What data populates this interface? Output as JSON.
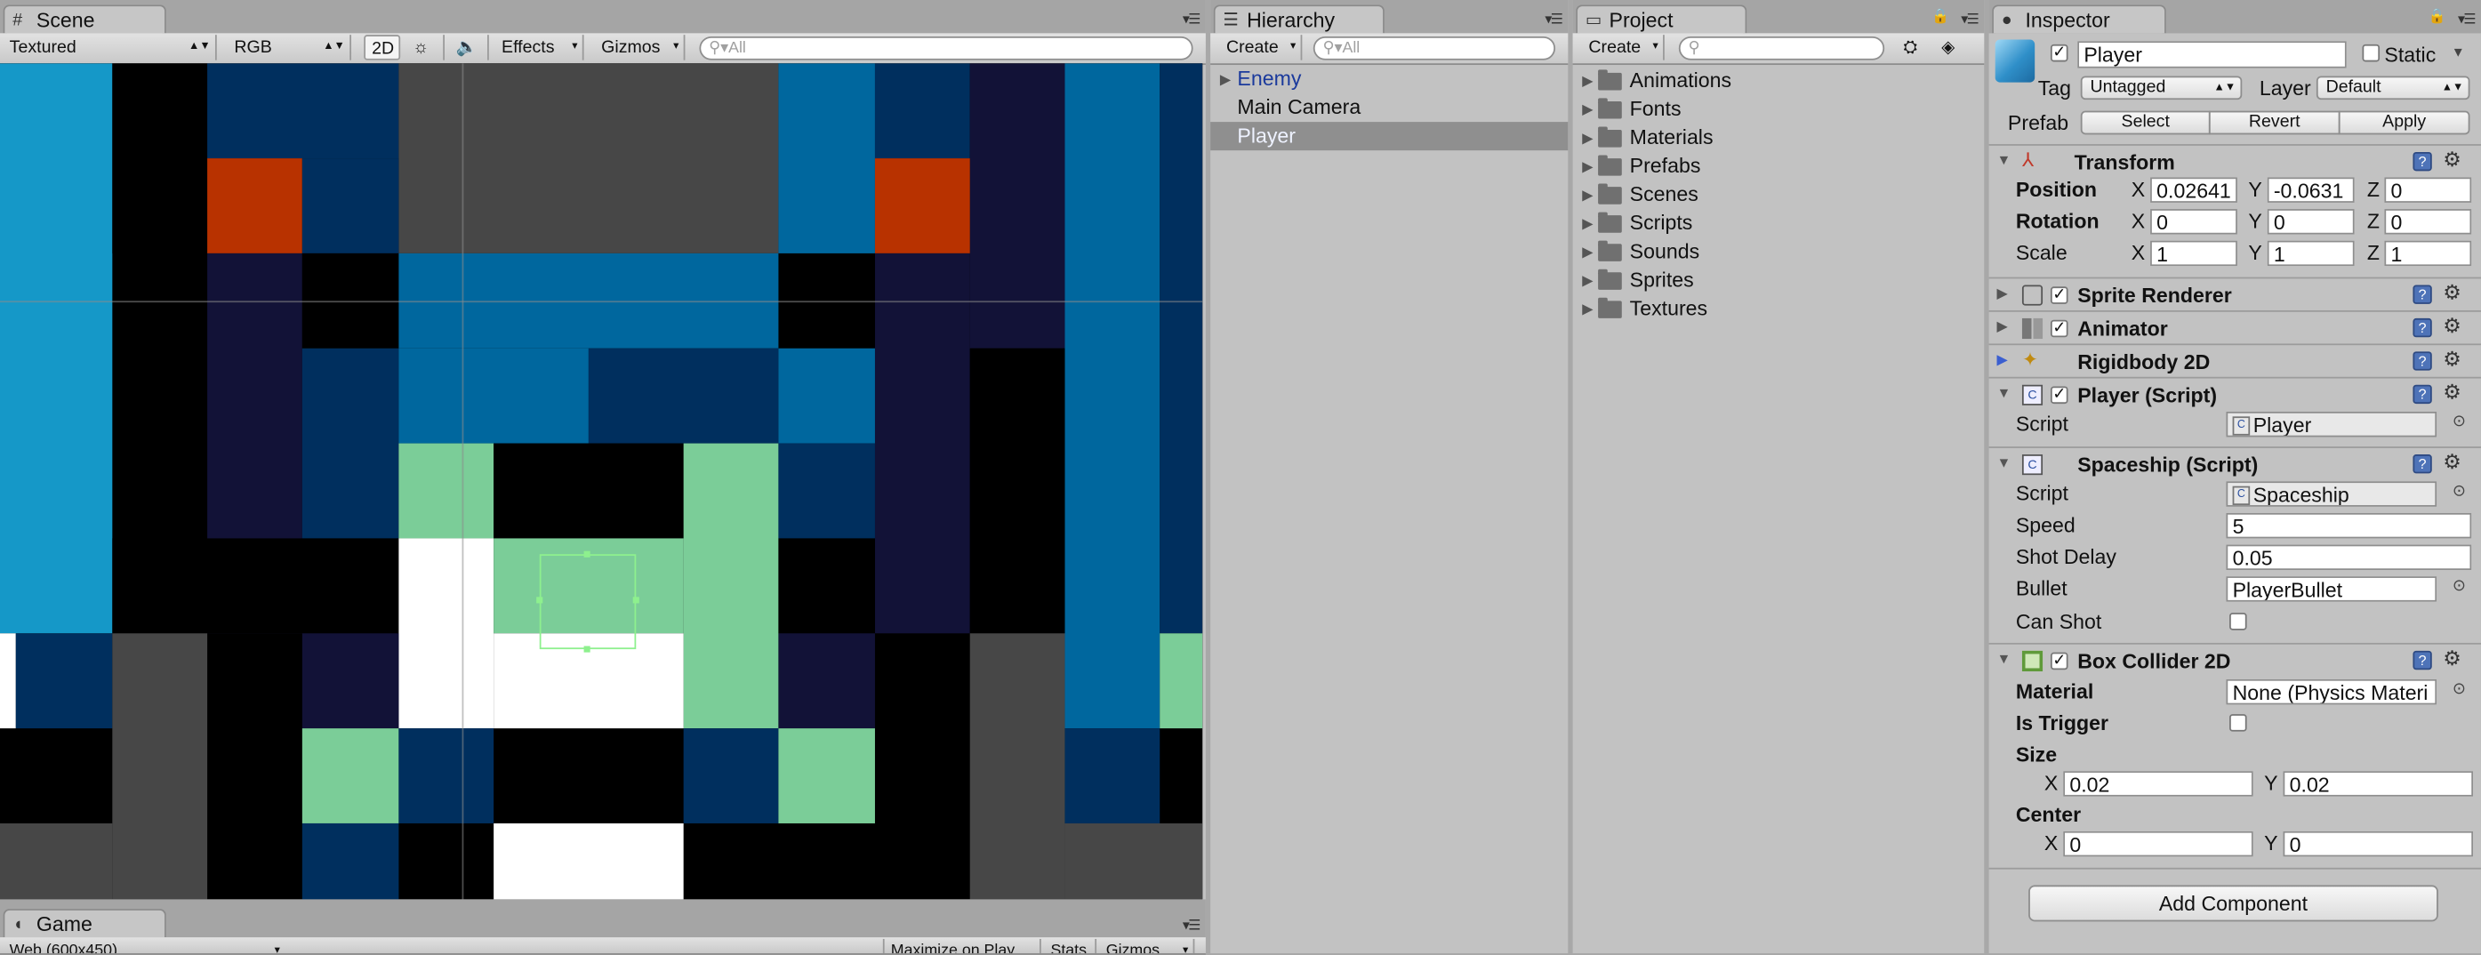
{
  "scene": {
    "tab": "Scene",
    "toolbar": {
      "draw_mode": "Textured",
      "color_mode": "RGB",
      "mode_2d": "2D",
      "effects": "Effects",
      "gizmos": "Gizmos",
      "search_placeholder": "All"
    },
    "colors": {
      "light_blue": "#1598c8",
      "mid_blue": "#00679e",
      "dark_blue": "#002f5e",
      "navy": "#121237",
      "gray": "#474747",
      "orange": "#b83200",
      "mint": "#7bcd98",
      "white": "#ffffff",
      "black": "#000000"
    }
  },
  "game": {
    "tab": "Game",
    "resolution": "Web (600x450)",
    "maximize": "Maximize on Play",
    "stats": "Stats",
    "gizmos": "Gizmos"
  },
  "hierarchy": {
    "tab": "Hierarchy",
    "create": "Create",
    "search_placeholder": "All",
    "items": [
      {
        "label": "Enemy",
        "prefab": true,
        "expandable": true
      },
      {
        "label": "Main Camera"
      },
      {
        "label": "Player",
        "selected": true
      }
    ]
  },
  "project": {
    "tab": "Project",
    "create": "Create",
    "folders": [
      "Animations",
      "Fonts",
      "Materials",
      "Prefabs",
      "Scenes",
      "Scripts",
      "Sounds",
      "Sprites",
      "Textures"
    ]
  },
  "inspector": {
    "tab": "Inspector",
    "object_name": "Player",
    "static_label": "Static",
    "tag_label": "Tag",
    "tag_value": "Untagged",
    "layer_label": "Layer",
    "layer_value": "Default",
    "prefab_label": "Prefab",
    "prefab_buttons": [
      "Select",
      "Revert",
      "Apply"
    ],
    "transform": {
      "title": "Transform",
      "position_label": "Position",
      "position": {
        "x": "0.02641",
        "y": "-0.0631",
        "z": "0"
      },
      "rotation_label": "Rotation",
      "rotation": {
        "x": "0",
        "y": "0",
        "z": "0"
      },
      "scale_label": "Scale",
      "scale": {
        "x": "1",
        "y": "1",
        "z": "1"
      },
      "axis": {
        "x": "X",
        "y": "Y",
        "z": "Z"
      }
    },
    "sprite_renderer": "Sprite Renderer",
    "animator": "Animator",
    "rigidbody": "Rigidbody 2D",
    "player_script": {
      "title": "Player (Script)",
      "script_label": "Script",
      "script_value": "Player"
    },
    "spaceship_script": {
      "title": "Spaceship (Script)",
      "script_label": "Script",
      "script_value": "Spaceship",
      "speed_label": "Speed",
      "speed": "5",
      "shot_delay_label": "Shot Delay",
      "shot_delay": "0.05",
      "bullet_label": "Bullet",
      "bullet": "PlayerBullet",
      "can_shot_label": "Can Shot"
    },
    "box_collider": {
      "title": "Box Collider 2D",
      "material_label": "Material",
      "material": "None (Physics Materi",
      "is_trigger_label": "Is Trigger",
      "size_label": "Size",
      "size": {
        "x": "0.02",
        "y": "0.02"
      },
      "center_label": "Center",
      "center": {
        "x": "0",
        "y": "0"
      }
    },
    "add_component": "Add Component"
  }
}
